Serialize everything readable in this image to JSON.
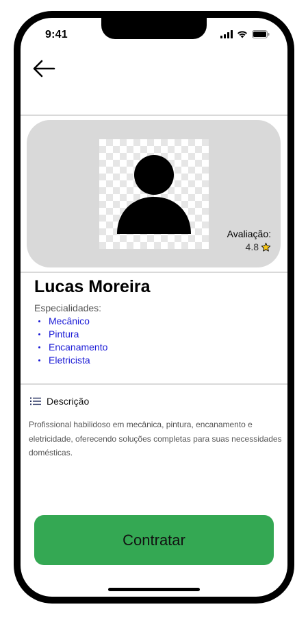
{
  "status_bar": {
    "time": "9:41"
  },
  "profile": {
    "name": "Lucas Moreira",
    "rating_label": "Avaliação:",
    "rating_value": "4.8",
    "rating_icon": "star-icon",
    "specialties_title": "Especialidades:",
    "specialties": [
      "Mecânico",
      "Pintura",
      "Encanamento",
      "Eletricista"
    ]
  },
  "description": {
    "icon": "list-icon",
    "title": "Descrição",
    "text": "Profissional habilidoso em mecânica, pintura, encanamento e eletricidade, oferecendo soluções completas para suas necessidades domésticas."
  },
  "actions": {
    "hire_label": "Contratar"
  },
  "colors": {
    "card_bg": "#d9d9d9",
    "specialty_link": "#1a1ad6",
    "hire_button": "#34a853",
    "star": "#f5c518"
  }
}
